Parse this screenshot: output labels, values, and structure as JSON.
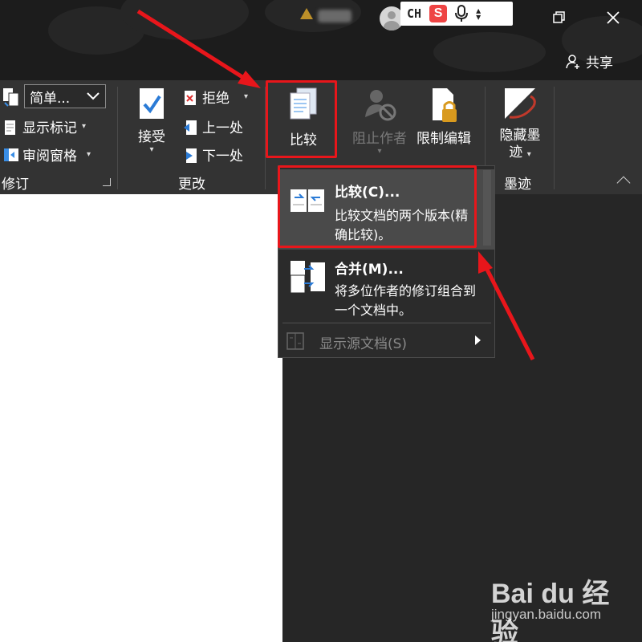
{
  "title_bar": {
    "ime_lang": "CH",
    "ime_brand_glyph": "S",
    "share_label": "共享",
    "restore_icon": "restore-icon",
    "close_icon": "close-icon"
  },
  "ribbon": {
    "revision_group": {
      "label": "修订",
      "markup_view": "简单...",
      "show_markup": "显示标记",
      "review_pane": "审阅窗格"
    },
    "changes_group": {
      "label": "更改",
      "accept": "接受",
      "reject": "拒绝",
      "previous": "上一处",
      "next": "下一处"
    },
    "compare_group": {
      "compare": "比较"
    },
    "protect_group": {
      "block_authors": "阻止作者",
      "restrict_editing": "限制编辑"
    },
    "ink_group": {
      "label": "墨迹",
      "hide_ink_line1": "隐藏墨",
      "hide_ink_line2": "迹"
    }
  },
  "compare_menu": {
    "items": [
      {
        "title": "比较(C)...",
        "desc": "比较文档的两个版本(精确比较)。",
        "icon": "compare-docs-icon"
      },
      {
        "title": "合并(M)...",
        "desc": "将多位作者的修订组合到一个文档中。",
        "icon": "combine-docs-icon"
      },
      {
        "title": "显示源文档(S)",
        "icon": "source-docs-icon"
      }
    ]
  },
  "watermark": {
    "brand": "Bai du 经验",
    "url": "jingyan.baidu.com"
  },
  "colors": {
    "annotation_red": "#e8161b",
    "ribbon_bg": "#333333",
    "titlebar_bg": "#1c1c1c",
    "menu_highlight": "#4a4a4a"
  }
}
